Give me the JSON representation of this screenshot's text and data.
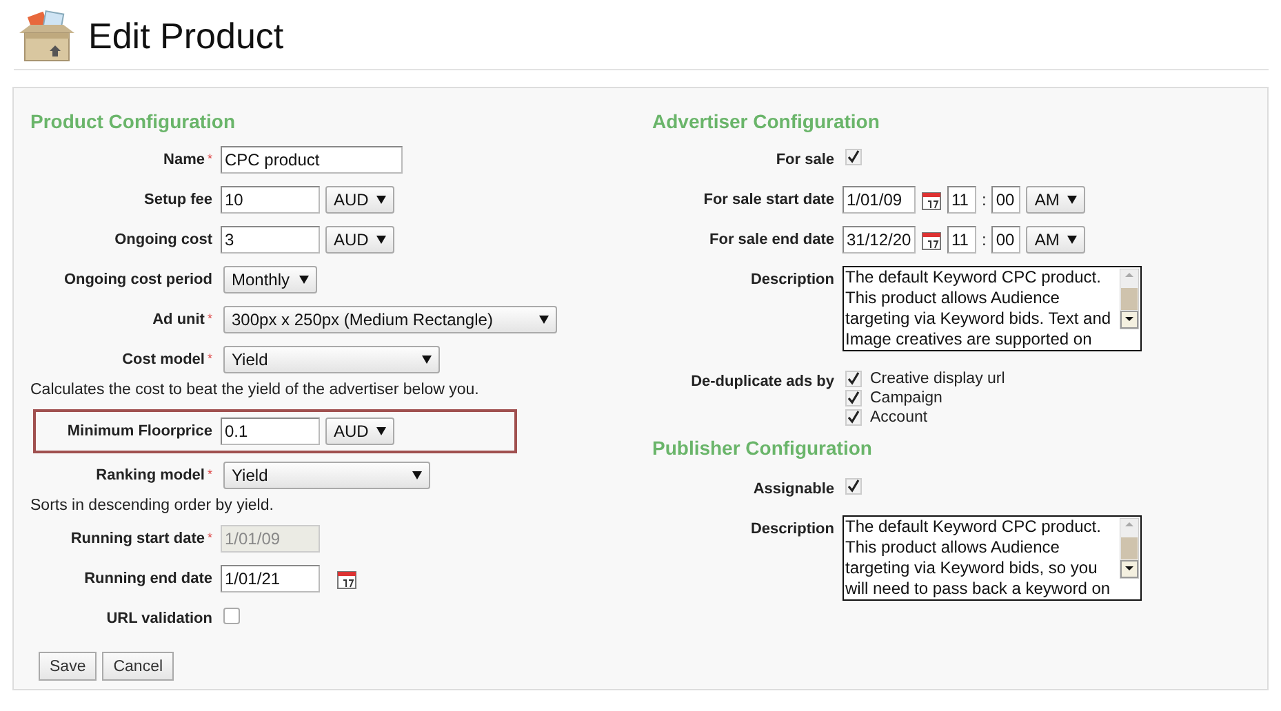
{
  "page": {
    "title": "Edit Product"
  },
  "product_configuration": {
    "heading": "Product Configuration",
    "rows": [
      {
        "kind": "text",
        "label": "Name",
        "required_mark": "*",
        "value": "CPC product"
      },
      {
        "kind": "money",
        "label": "Setup fee",
        "value": "10",
        "currency": "AUD",
        "highlighted": false
      },
      {
        "kind": "money",
        "label": "Ongoing cost",
        "value": "3",
        "currency": "AUD",
        "highlighted": false
      },
      {
        "kind": "select",
        "label": "Ongoing cost period",
        "value": "Monthly"
      },
      {
        "kind": "select",
        "label": "Ad unit",
        "required_mark": "*",
        "value": "300px x 250px (Medium Rectangle)"
      },
      {
        "kind": "select",
        "label": "Cost model",
        "required_mark": "*",
        "value": "Yield"
      },
      {
        "kind": "note",
        "text": "Calculates the cost to beat the yield of the advertiser below you."
      },
      {
        "kind": "money",
        "label": "Minimum Floorprice",
        "value": "0.1",
        "currency": "AUD",
        "highlighted": true
      },
      {
        "kind": "select",
        "label": "Ranking model",
        "required_mark": "*",
        "value": "Yield"
      },
      {
        "kind": "note",
        "text": "Sorts in descending order by yield."
      },
      {
        "kind": "date",
        "label": "Running start date",
        "required_mark": "*",
        "value": "1/01/09",
        "disabled": true
      },
      {
        "kind": "date",
        "label": "Running end date",
        "value": "1/01/21",
        "disabled": false
      },
      {
        "kind": "checkbox",
        "label": "URL validation",
        "checked": false
      }
    ],
    "buttons": [
      "Save",
      "Cancel"
    ]
  },
  "advertiser_configuration": {
    "heading": "Advertiser Configuration",
    "rows": [
      {
        "kind": "checkbox",
        "label": "For sale",
        "checked": true
      },
      {
        "kind": "datetime",
        "label": "For sale start date",
        "value": "1/01/09",
        "hour": "11",
        "separator": ":",
        "minute": "00",
        "meridiem": "AM"
      },
      {
        "kind": "datetime",
        "label": "For sale end date",
        "value": "31/12/20",
        "hour": "11",
        "separator": ":",
        "minute": "00",
        "meridiem": "AM"
      },
      {
        "kind": "textarea",
        "label": "Description",
        "value": "The default Keyword CPC product. This product allows Audience targeting via Keyword bids. Text and Image creatives are supported on"
      },
      {
        "kind": "checklist",
        "label": "De-duplicate ads by",
        "options": [
          {
            "label": "Creative display url",
            "checked": true
          },
          {
            "label": "Campaign",
            "checked": true
          },
          {
            "label": "Account",
            "checked": true
          }
        ]
      }
    ]
  },
  "publisher_configuration": {
    "heading": "Publisher Configuration",
    "rows": [
      {
        "kind": "checkbox",
        "label": "Assignable",
        "checked": true
      },
      {
        "kind": "textarea",
        "label": "Description",
        "value": "The default Keyword CPC product. This product allows Audience targeting via Keyword bids, so you will need to pass back a keyword on"
      }
    ]
  }
}
